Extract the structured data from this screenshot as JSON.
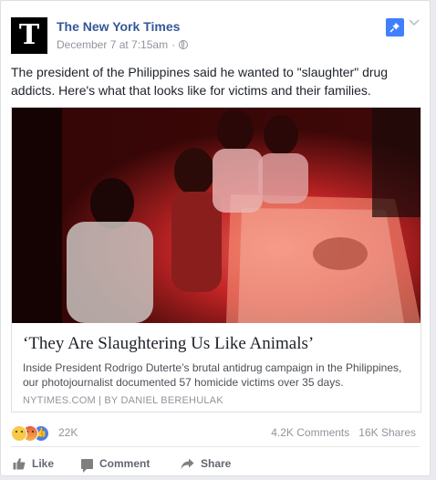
{
  "post": {
    "page_name": "The New York Times",
    "avatar_letter": "T",
    "date": "December 7 at 7:15am",
    "separator": "·",
    "text": "The president of the Philippines said he wanted to \"slaughter\" drug addicts. Here's what that looks like for victims and their families."
  },
  "link": {
    "title": "‘They Are Slaughtering Us Like Animals’",
    "description": "Inside President Rodrigo Duterte’s brutal antidrug campaign in the Philippines, our photojournalist documented 57 homicide victims over 35 days.",
    "source": "NYTIMES.COM | BY DANIEL BEREHULAK"
  },
  "engagement": {
    "reaction_icons": [
      "sad-emoji-icon",
      "angry-emoji-icon",
      "like-emoji-icon"
    ],
    "reaction_count": "22K",
    "comments": "4.2K Comments",
    "shares": "16K Shares"
  },
  "actions": {
    "like": "Like",
    "comment": "Comment",
    "share": "Share"
  },
  "colors": {
    "page_name": "#365899",
    "pin_button": "#4080ff",
    "meta_text": "#90949c"
  }
}
